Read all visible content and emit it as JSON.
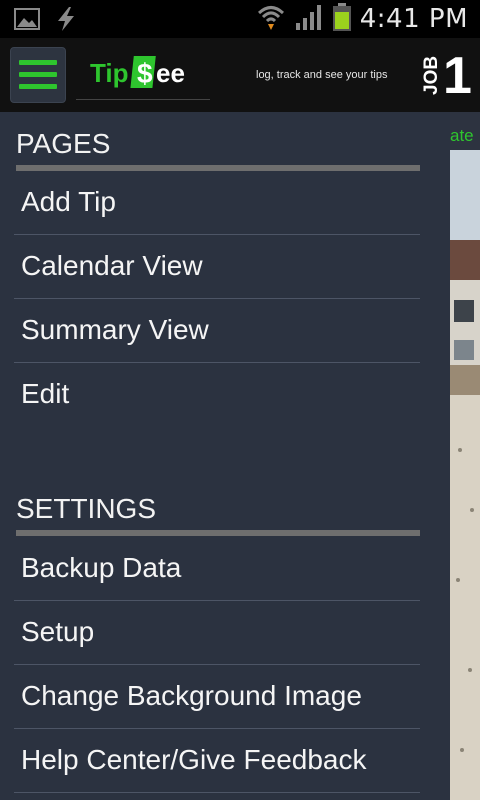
{
  "status_bar": {
    "time": "4:41 PM",
    "icons": [
      "gallery-notification-icon",
      "flash-notification-icon",
      "wifi-icon",
      "signal-icon",
      "battery-icon"
    ]
  },
  "action_bar": {
    "logo": {
      "text_a": "Tip",
      "dollar": "$",
      "text_b": "ee"
    },
    "tagline": "log, track and see your tips",
    "job_label": "JOB",
    "job_number": "1"
  },
  "background": {
    "link_fragment": "ate"
  },
  "drawer": {
    "pages_header": "PAGES",
    "pages": [
      "Add Tip",
      "Calendar View",
      "Summary View",
      "Edit"
    ],
    "settings_header": "SETTINGS",
    "settings": [
      "Backup Data",
      "Setup",
      "Change Background Image",
      "Help Center/Give Feedback"
    ]
  },
  "colors": {
    "accent_green": "#2ec52e",
    "drawer_bg": "#2b3240",
    "action_bar_bg": "#111111",
    "status_bar_bg": "#000000",
    "battery_green": "#9bd21d"
  }
}
